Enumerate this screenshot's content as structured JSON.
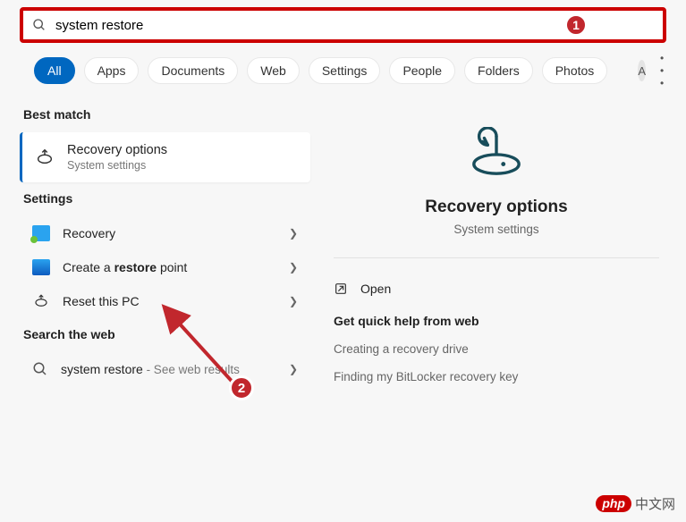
{
  "search": {
    "query": "system restore",
    "placeholder": ""
  },
  "annotations": {
    "badge1": "1",
    "badge2": "2"
  },
  "filters": {
    "items": [
      "All",
      "Apps",
      "Documents",
      "Web",
      "Settings",
      "People",
      "Folders",
      "Photos"
    ],
    "avatar_initial": "A"
  },
  "left": {
    "best_match_h": "Best match",
    "best_match": {
      "title": "Recovery options",
      "subtitle": "System settings"
    },
    "settings_h": "Settings",
    "settings_items": [
      {
        "label": "Recovery",
        "bold": ""
      },
      {
        "label_pre": "Create a ",
        "bold": "restore",
        "label_post": " point"
      },
      {
        "label": "Reset this PC",
        "bold": ""
      }
    ],
    "web_h": "Search the web",
    "web_item": {
      "term": "system restore",
      "suffix": " - See web results"
    }
  },
  "right": {
    "hero_title": "Recovery options",
    "hero_sub": "System settings",
    "open_label": "Open",
    "help_h": "Get quick help from web",
    "help_links": [
      "Creating a recovery drive",
      "Finding my BitLocker recovery key"
    ]
  },
  "watermark": {
    "pill": "php",
    "text": "中文网"
  }
}
